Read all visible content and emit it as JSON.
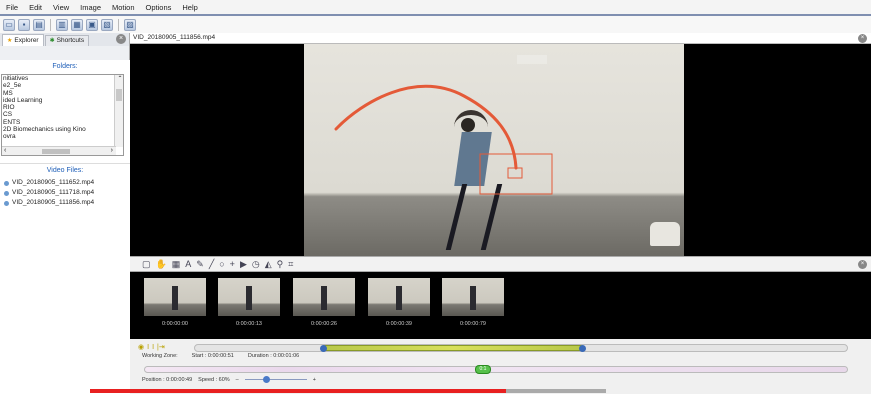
{
  "menu": [
    "File",
    "Edit",
    "View",
    "Image",
    "Motion",
    "Options",
    "Help"
  ],
  "left": {
    "tabs": [
      "Explorer",
      "Shortcuts"
    ],
    "folders_title": "Folders:",
    "folders": [
      "nitiatives",
      "e2_5e",
      "MS",
      "ided Learning",
      "RIO",
      "CS",
      "ENTS",
      "2D Biomechanics using Kino",
      "ovra"
    ],
    "video_title": "Video Files:",
    "videos": [
      "VID_20180905_111652.mp4",
      "VID_20180905_111718.mp4",
      "VID_20180905_111856.mp4"
    ]
  },
  "video": {
    "filename": "VID_20180905_111856.mp4"
  },
  "thumbs": [
    "0:00:00:00",
    "0:00:00:13",
    "0:00:00:26",
    "0:00:00:39",
    "0:00:00:79"
  ],
  "timeline": {
    "working_zone": "Working Zone:",
    "start": "Start : 0:00:00:51",
    "duration": "Duration : 0:00:01:06",
    "position": "Position : 0:00:00:49",
    "speed": "Speed : 60%",
    "marker": "0:1"
  },
  "colors": {
    "trajectory": "#e45a38",
    "accent": "#1f5fb8"
  }
}
